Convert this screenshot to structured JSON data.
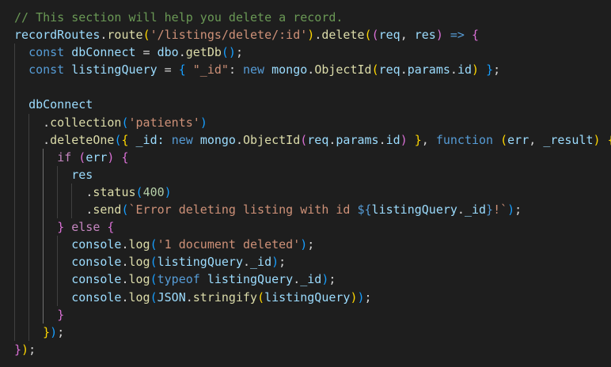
{
  "editor": {
    "lines": [
      {
        "tokens": [
          {
            "t": "// This section will help you delete a record.",
            "c": "comment"
          }
        ]
      },
      {
        "tokens": [
          {
            "t": "recordRoutes",
            "c": "var"
          },
          {
            "t": ".",
            "c": "plain"
          },
          {
            "t": "route",
            "c": "fn"
          },
          {
            "t": "(",
            "c": "b1"
          },
          {
            "t": "'/listings/delete/:id'",
            "c": "str"
          },
          {
            "t": ")",
            "c": "b1"
          },
          {
            "t": ".",
            "c": "plain"
          },
          {
            "t": "delete",
            "c": "fn"
          },
          {
            "t": "(",
            "c": "b1"
          },
          {
            "t": "(",
            "c": "b2"
          },
          {
            "t": "req",
            "c": "var"
          },
          {
            "t": ", ",
            "c": "plain"
          },
          {
            "t": "res",
            "c": "var"
          },
          {
            "t": ")",
            "c": "b2"
          },
          {
            "t": " ",
            "c": "plain"
          },
          {
            "t": "=>",
            "c": "kw"
          },
          {
            "t": " ",
            "c": "plain"
          },
          {
            "t": "{",
            "c": "b2"
          }
        ]
      },
      {
        "tokens": [
          {
            "t": "  ",
            "c": "plain"
          },
          {
            "t": "const",
            "c": "kw"
          },
          {
            "t": " ",
            "c": "plain"
          },
          {
            "t": "dbConnect",
            "c": "var"
          },
          {
            "t": " = ",
            "c": "plain"
          },
          {
            "t": "dbo",
            "c": "var"
          },
          {
            "t": ".",
            "c": "plain"
          },
          {
            "t": "getDb",
            "c": "fn"
          },
          {
            "t": "()",
            "c": "b3"
          },
          {
            "t": ";",
            "c": "plain"
          }
        ]
      },
      {
        "tokens": [
          {
            "t": "  ",
            "c": "plain"
          },
          {
            "t": "const",
            "c": "kw"
          },
          {
            "t": " ",
            "c": "plain"
          },
          {
            "t": "listingQuery",
            "c": "var"
          },
          {
            "t": " = ",
            "c": "plain"
          },
          {
            "t": "{",
            "c": "b3"
          },
          {
            "t": " ",
            "c": "plain"
          },
          {
            "t": "\"_id\"",
            "c": "str"
          },
          {
            "t": ": ",
            "c": "plain"
          },
          {
            "t": "new",
            "c": "kw"
          },
          {
            "t": " ",
            "c": "plain"
          },
          {
            "t": "mongo",
            "c": "var"
          },
          {
            "t": ".",
            "c": "plain"
          },
          {
            "t": "ObjectId",
            "c": "fn"
          },
          {
            "t": "(",
            "c": "b1"
          },
          {
            "t": "req",
            "c": "var"
          },
          {
            "t": ".",
            "c": "plain"
          },
          {
            "t": "params",
            "c": "var"
          },
          {
            "t": ".",
            "c": "plain"
          },
          {
            "t": "id",
            "c": "var"
          },
          {
            "t": ")",
            "c": "b1"
          },
          {
            "t": " ",
            "c": "plain"
          },
          {
            "t": "}",
            "c": "b3"
          },
          {
            "t": ";",
            "c": "plain"
          }
        ]
      },
      {
        "tokens": []
      },
      {
        "tokens": [
          {
            "t": "  ",
            "c": "plain"
          },
          {
            "t": "dbConnect",
            "c": "var"
          }
        ]
      },
      {
        "tokens": [
          {
            "t": "    ",
            "c": "plain"
          },
          {
            "t": ".",
            "c": "plain"
          },
          {
            "t": "collection",
            "c": "fn"
          },
          {
            "t": "(",
            "c": "b3"
          },
          {
            "t": "'patients'",
            "c": "str"
          },
          {
            "t": ")",
            "c": "b3"
          }
        ]
      },
      {
        "tokens": [
          {
            "t": "    ",
            "c": "plain"
          },
          {
            "t": ".",
            "c": "plain"
          },
          {
            "t": "deleteOne",
            "c": "fn"
          },
          {
            "t": "(",
            "c": "b3"
          },
          {
            "t": "{",
            "c": "b1"
          },
          {
            "t": " _id: ",
            "c": "prop"
          },
          {
            "t": "new",
            "c": "kw"
          },
          {
            "t": " ",
            "c": "plain"
          },
          {
            "t": "mongo",
            "c": "var"
          },
          {
            "t": ".",
            "c": "plain"
          },
          {
            "t": "ObjectId",
            "c": "fn"
          },
          {
            "t": "(",
            "c": "b2"
          },
          {
            "t": "req",
            "c": "var"
          },
          {
            "t": ".",
            "c": "plain"
          },
          {
            "t": "params",
            "c": "var"
          },
          {
            "t": ".",
            "c": "plain"
          },
          {
            "t": "id",
            "c": "var"
          },
          {
            "t": ")",
            "c": "b2"
          },
          {
            "t": " ",
            "c": "plain"
          },
          {
            "t": "}",
            "c": "b1"
          },
          {
            "t": ", ",
            "c": "plain"
          },
          {
            "t": "function",
            "c": "kw"
          },
          {
            "t": " ",
            "c": "plain"
          },
          {
            "t": "(",
            "c": "b1"
          },
          {
            "t": "err",
            "c": "var"
          },
          {
            "t": ", ",
            "c": "plain"
          },
          {
            "t": "_result",
            "c": "var"
          },
          {
            "t": ")",
            "c": "b1"
          },
          {
            "t": " ",
            "c": "plain"
          },
          {
            "t": "{",
            "c": "b1"
          }
        ]
      },
      {
        "tokens": [
          {
            "t": "      ",
            "c": "plain"
          },
          {
            "t": "if",
            "c": "ctrl"
          },
          {
            "t": " ",
            "c": "plain"
          },
          {
            "t": "(",
            "c": "b2"
          },
          {
            "t": "err",
            "c": "var"
          },
          {
            "t": ")",
            "c": "b2"
          },
          {
            "t": " ",
            "c": "plain"
          },
          {
            "t": "{",
            "c": "b2"
          }
        ]
      },
      {
        "tokens": [
          {
            "t": "        ",
            "c": "plain"
          },
          {
            "t": "res",
            "c": "var"
          }
        ]
      },
      {
        "tokens": [
          {
            "t": "          ",
            "c": "plain"
          },
          {
            "t": ".",
            "c": "plain"
          },
          {
            "t": "status",
            "c": "fn"
          },
          {
            "t": "(",
            "c": "b3"
          },
          {
            "t": "400",
            "c": "num"
          },
          {
            "t": ")",
            "c": "b3"
          }
        ]
      },
      {
        "tokens": [
          {
            "t": "          ",
            "c": "plain"
          },
          {
            "t": ".",
            "c": "plain"
          },
          {
            "t": "send",
            "c": "fn"
          },
          {
            "t": "(",
            "c": "b3"
          },
          {
            "t": "`Error deleting listing with id ",
            "c": "str"
          },
          {
            "t": "${",
            "c": "kw"
          },
          {
            "t": "listingQuery",
            "c": "var"
          },
          {
            "t": ".",
            "c": "plain"
          },
          {
            "t": "_id",
            "c": "var"
          },
          {
            "t": "}",
            "c": "kw"
          },
          {
            "t": "!`",
            "c": "str"
          },
          {
            "t": ")",
            "c": "b3"
          },
          {
            "t": ";",
            "c": "plain"
          }
        ]
      },
      {
        "tokens": [
          {
            "t": "      ",
            "c": "plain"
          },
          {
            "t": "}",
            "c": "b2"
          },
          {
            "t": " ",
            "c": "plain"
          },
          {
            "t": "else",
            "c": "ctrl"
          },
          {
            "t": " ",
            "c": "plain"
          },
          {
            "t": "{",
            "c": "b2"
          }
        ]
      },
      {
        "tokens": [
          {
            "t": "        ",
            "c": "plain"
          },
          {
            "t": "console",
            "c": "var"
          },
          {
            "t": ".",
            "c": "plain"
          },
          {
            "t": "log",
            "c": "fn"
          },
          {
            "t": "(",
            "c": "b3"
          },
          {
            "t": "'1 document deleted'",
            "c": "str"
          },
          {
            "t": ")",
            "c": "b3"
          },
          {
            "t": ";",
            "c": "plain"
          }
        ]
      },
      {
        "tokens": [
          {
            "t": "        ",
            "c": "plain"
          },
          {
            "t": "console",
            "c": "var"
          },
          {
            "t": ".",
            "c": "plain"
          },
          {
            "t": "log",
            "c": "fn"
          },
          {
            "t": "(",
            "c": "b3"
          },
          {
            "t": "listingQuery",
            "c": "var"
          },
          {
            "t": ".",
            "c": "plain"
          },
          {
            "t": "_id",
            "c": "var"
          },
          {
            "t": ")",
            "c": "b3"
          },
          {
            "t": ";",
            "c": "plain"
          }
        ]
      },
      {
        "tokens": [
          {
            "t": "        ",
            "c": "plain"
          },
          {
            "t": "console",
            "c": "var"
          },
          {
            "t": ".",
            "c": "plain"
          },
          {
            "t": "log",
            "c": "fn"
          },
          {
            "t": "(",
            "c": "b3"
          },
          {
            "t": "typeof",
            "c": "kw"
          },
          {
            "t": " ",
            "c": "plain"
          },
          {
            "t": "listingQuery",
            "c": "var"
          },
          {
            "t": ".",
            "c": "plain"
          },
          {
            "t": "_id",
            "c": "var"
          },
          {
            "t": ")",
            "c": "b3"
          },
          {
            "t": ";",
            "c": "plain"
          }
        ]
      },
      {
        "tokens": [
          {
            "t": "        ",
            "c": "plain"
          },
          {
            "t": "console",
            "c": "var"
          },
          {
            "t": ".",
            "c": "plain"
          },
          {
            "t": "log",
            "c": "fn"
          },
          {
            "t": "(",
            "c": "b3"
          },
          {
            "t": "JSON",
            "c": "var"
          },
          {
            "t": ".",
            "c": "plain"
          },
          {
            "t": "stringify",
            "c": "fn"
          },
          {
            "t": "(",
            "c": "b1"
          },
          {
            "t": "listingQuery",
            "c": "var"
          },
          {
            "t": ")",
            "c": "b1"
          },
          {
            "t": ")",
            "c": "b3"
          },
          {
            "t": ";",
            "c": "plain"
          }
        ]
      },
      {
        "tokens": [
          {
            "t": "      ",
            "c": "plain"
          },
          {
            "t": "}",
            "c": "b2"
          }
        ]
      },
      {
        "tokens": [
          {
            "t": "    ",
            "c": "plain"
          },
          {
            "t": "}",
            "c": "b1"
          },
          {
            "t": ")",
            "c": "b3"
          },
          {
            "t": ";",
            "c": "plain"
          }
        ]
      },
      {
        "tokens": [
          {
            "t": "}",
            "c": "b2"
          },
          {
            "t": ")",
            "c": "b1"
          },
          {
            "t": ";",
            "c": "plain"
          }
        ]
      }
    ]
  },
  "colors": {
    "background": "#1e1e1e",
    "comment": "#6a9955",
    "kw": "#569cd6",
    "ctrl": "#c586c0",
    "var": "#9cdcfe",
    "prop": "#9cdcfe",
    "fn": "#dcdcaa",
    "str": "#ce9178",
    "num": "#b5cea8",
    "plain": "#d4d4d4",
    "b1": "#ffd700",
    "b2": "#da70d6",
    "b3": "#179fff"
  }
}
